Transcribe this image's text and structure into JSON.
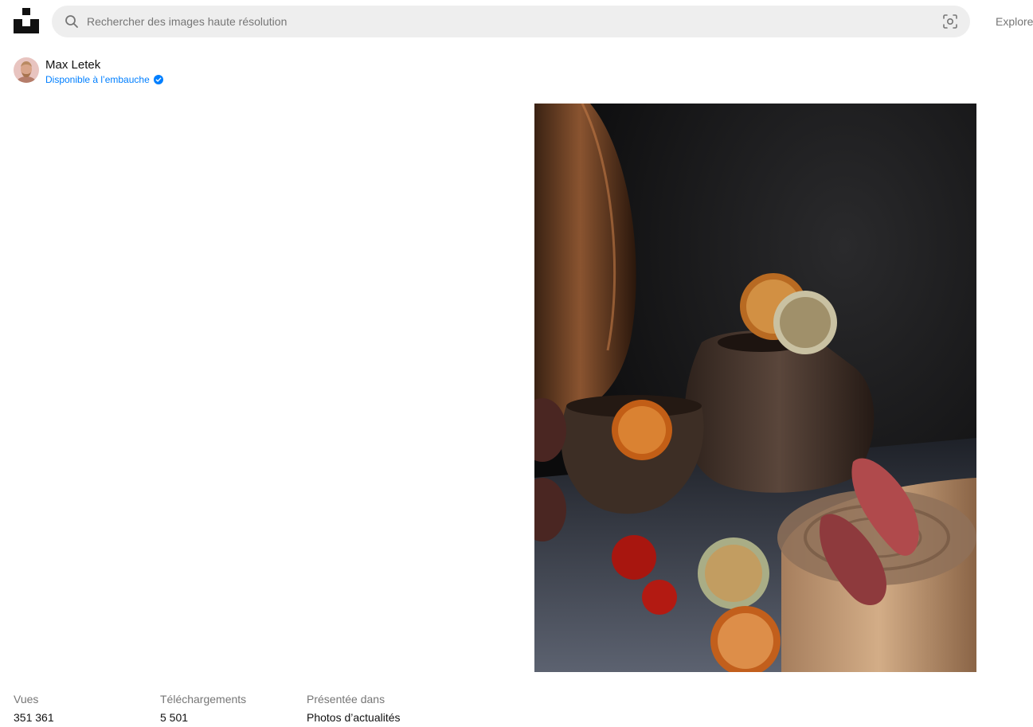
{
  "header": {
    "logo_icon": "unsplash-logo-icon",
    "search": {
      "placeholder": "Rechercher des images haute résolution",
      "value": "",
      "search_icon": "search-icon",
      "visual_search_icon": "visual-search-icon"
    },
    "nav": {
      "explore_label": "Explore"
    }
  },
  "author": {
    "name": "Max Letek",
    "status": "Disponible à l’embauche",
    "status_icon": "verified-check-icon",
    "status_color": "#007fff"
  },
  "photo": {
    "image_icon": "still-life-photo"
  },
  "stats": [
    {
      "label": "Vues",
      "value": "351 361"
    },
    {
      "label": "Téléchargements",
      "value": "5 501"
    },
    {
      "label": "Présentée dans",
      "value": "Photos d’actualités"
    }
  ],
  "colors": {
    "accent": "#007fff",
    "muted_text": "#767676",
    "search_bg": "#eeeeee"
  }
}
